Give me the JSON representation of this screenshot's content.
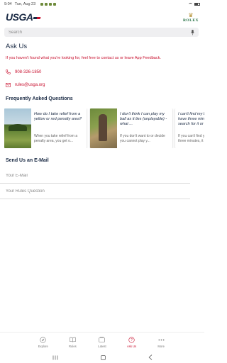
{
  "status_bar": {
    "time": "9:04",
    "date": "Tue, Aug 23",
    "battery": "71%"
  },
  "header": {
    "logo_text": "USGA",
    "sponsor_text": "ROLEX"
  },
  "search": {
    "placeholder": "Search"
  },
  "page": {
    "title": "Ask Us",
    "intro_text": "If you haven't found what you're looking for, feel free to contact us or leave ",
    "intro_link": "App Feedback",
    "intro_end": ".",
    "phone": "908-326-1850",
    "email": "rules@usga.org"
  },
  "faq": {
    "title": "Frequently Asked Questions",
    "cards": [
      {
        "question": "How do I take relief from a yellow or red penalty area?",
        "answer": "When you take relief from a penalty area, you get o..."
      },
      {
        "question": "I don't think I can play my ball as it lies (unplayable) - what ...",
        "answer": "If you don't want to or decide you cannot play y..."
      },
      {
        "question": "I can't find my ball - do I have three minutes to search for it or find options?",
        "answer": "If you can't find your ball within three minutes, it is lo..."
      }
    ]
  },
  "email_form": {
    "title": "Send Us an E-Mail",
    "email_placeholder": "Your E-Mail",
    "question_placeholder": "Your Rules Question"
  },
  "bottom_nav": [
    {
      "label": "Explore",
      "icon": "compass-icon",
      "active": false
    },
    {
      "label": "Rules",
      "icon": "book-icon",
      "active": false
    },
    {
      "label": "Latest",
      "icon": "news-icon",
      "active": false
    },
    {
      "label": "Ask Us",
      "icon": "question-icon",
      "active": true
    },
    {
      "label": "More",
      "icon": "more-dots-icon",
      "active": false
    }
  ],
  "colors": {
    "accent": "#c8102e",
    "navy": "#1a2a44"
  }
}
